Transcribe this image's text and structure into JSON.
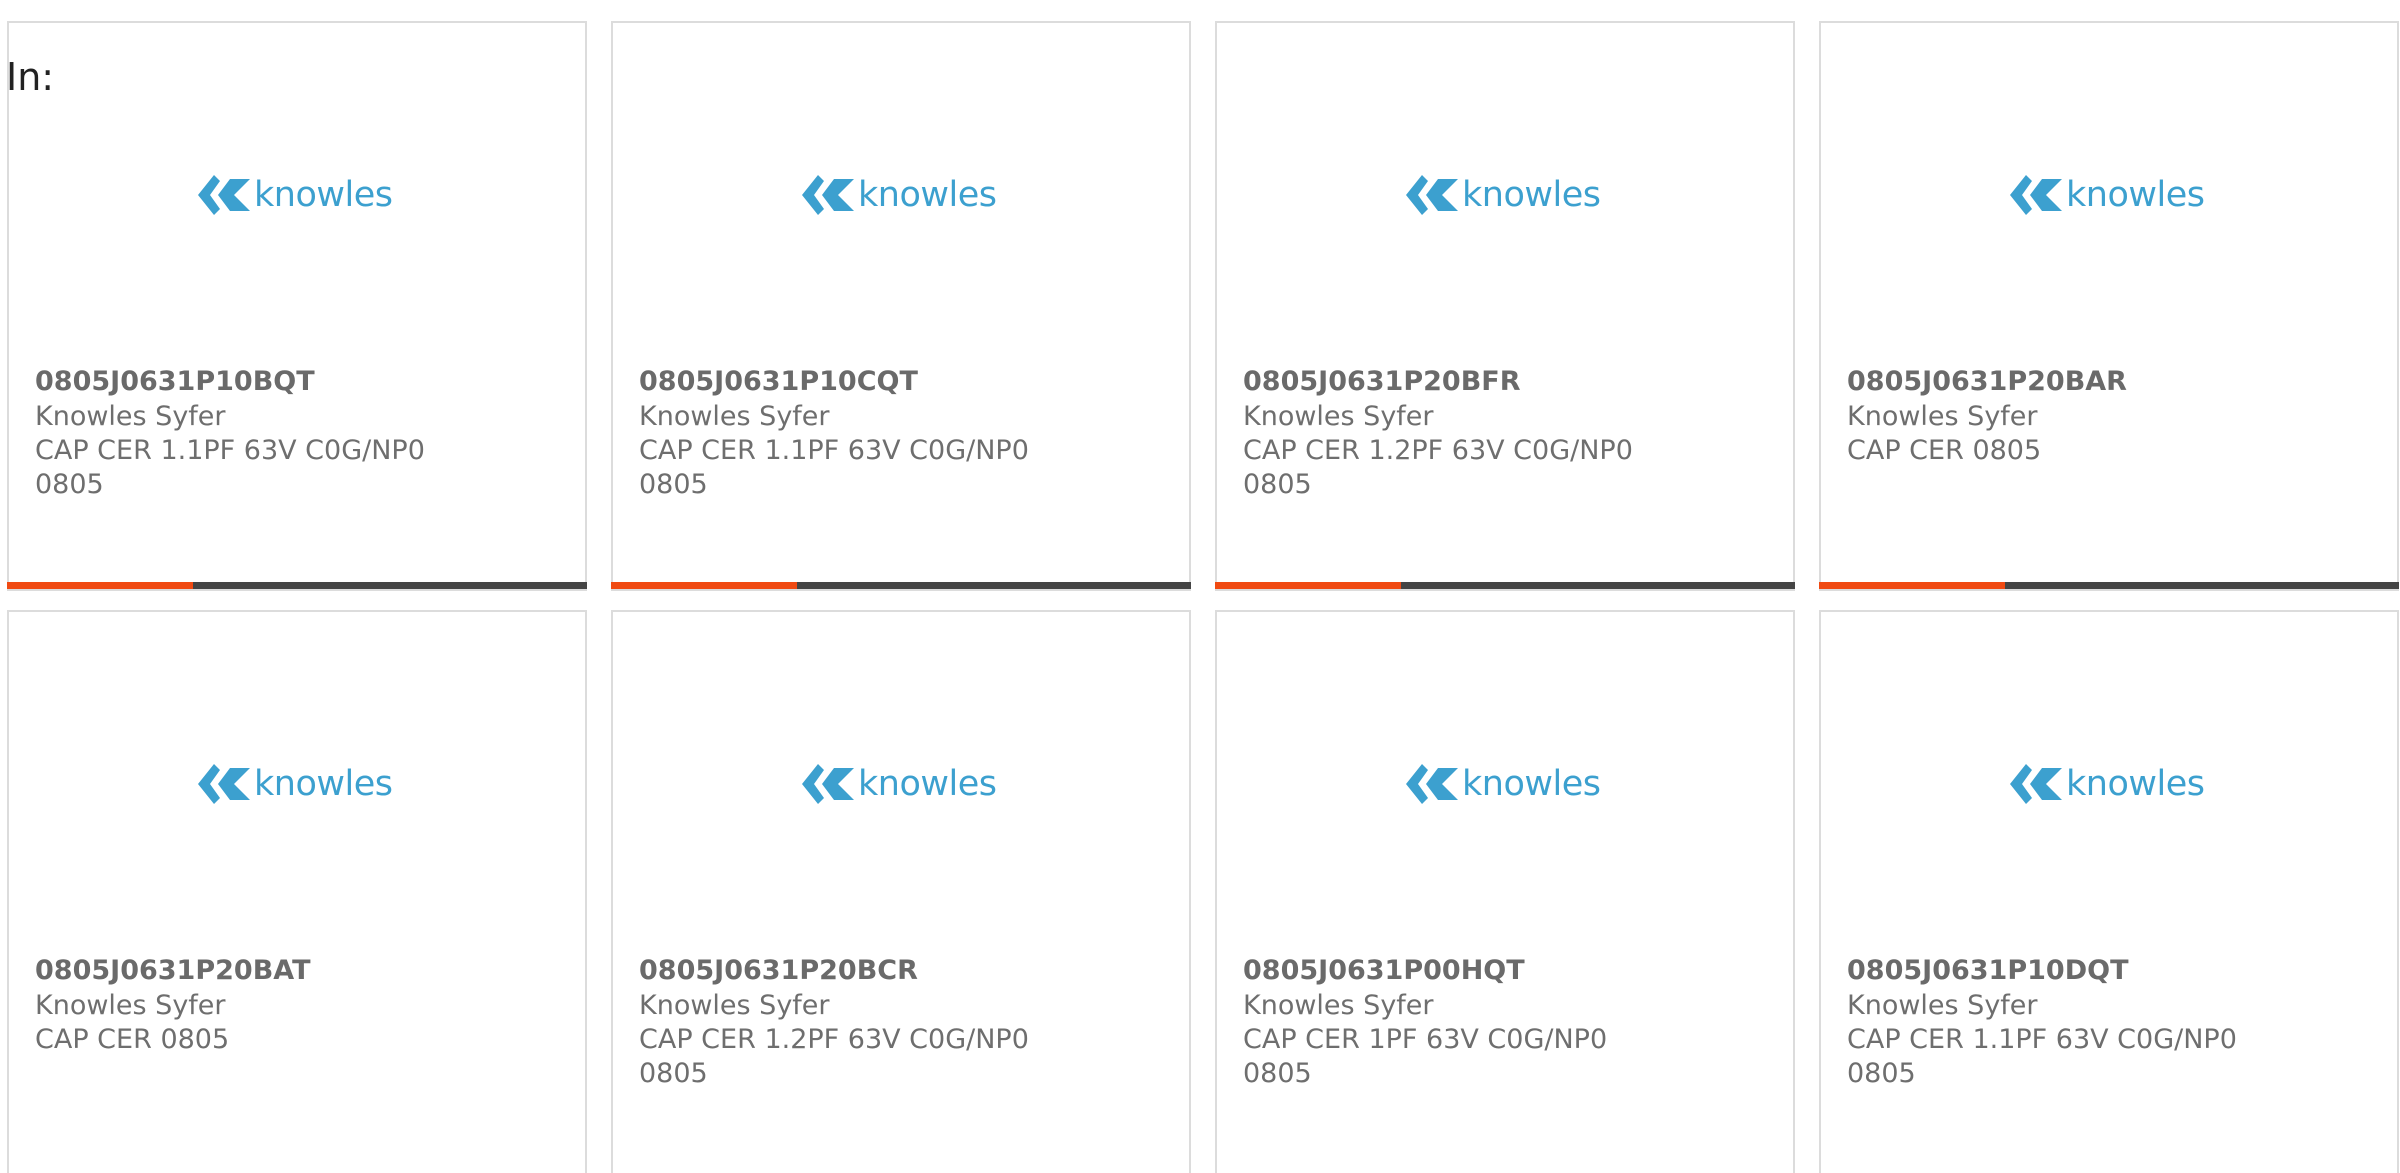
{
  "filter_label": "In:",
  "colors": {
    "logo_blue": "#3ca0cf",
    "progress_accent": "#f04a12",
    "progress_track": "#444444",
    "text_gray": "#6e6e6e",
    "card_border": "#dcdcdc"
  },
  "cards": [
    {
      "logo_text": "knowles",
      "part_number": "0805J0631P10BQT",
      "manufacturer": "Knowles Syfer",
      "description": "CAP CER 1.1PF 63V C0G/NP0 0805",
      "progress_fraction": 0.32
    },
    {
      "logo_text": "knowles",
      "part_number": "0805J0631P10CQT",
      "manufacturer": "Knowles Syfer",
      "description": "CAP CER 1.1PF 63V C0G/NP0 0805",
      "progress_fraction": 0.32
    },
    {
      "logo_text": "knowles",
      "part_number": "0805J0631P20BFR",
      "manufacturer": "Knowles Syfer",
      "description": "CAP CER 1.2PF 63V C0G/NP0 0805",
      "progress_fraction": 0.32
    },
    {
      "logo_text": "knowles",
      "part_number": "0805J0631P20BAR",
      "manufacturer": "Knowles Syfer",
      "description": "CAP CER 0805",
      "progress_fraction": 0.32
    },
    {
      "logo_text": "knowles",
      "part_number": "0805J0631P20BAT",
      "manufacturer": "Knowles Syfer",
      "description": "CAP CER 0805"
    },
    {
      "logo_text": "knowles",
      "part_number": "0805J0631P20BCR",
      "manufacturer": "Knowles Syfer",
      "description": "CAP CER 1.2PF 63V C0G/NP0 0805"
    },
    {
      "logo_text": "knowles",
      "part_number": "0805J0631P00HQT",
      "manufacturer": "Knowles Syfer",
      "description": "CAP CER 1PF 63V C0G/NP0 0805"
    },
    {
      "logo_text": "knowles",
      "part_number": "0805J0631P10DQT",
      "manufacturer": "Knowles Syfer",
      "description": "CAP CER 1.1PF 63V C0G/NP0 0805"
    }
  ]
}
